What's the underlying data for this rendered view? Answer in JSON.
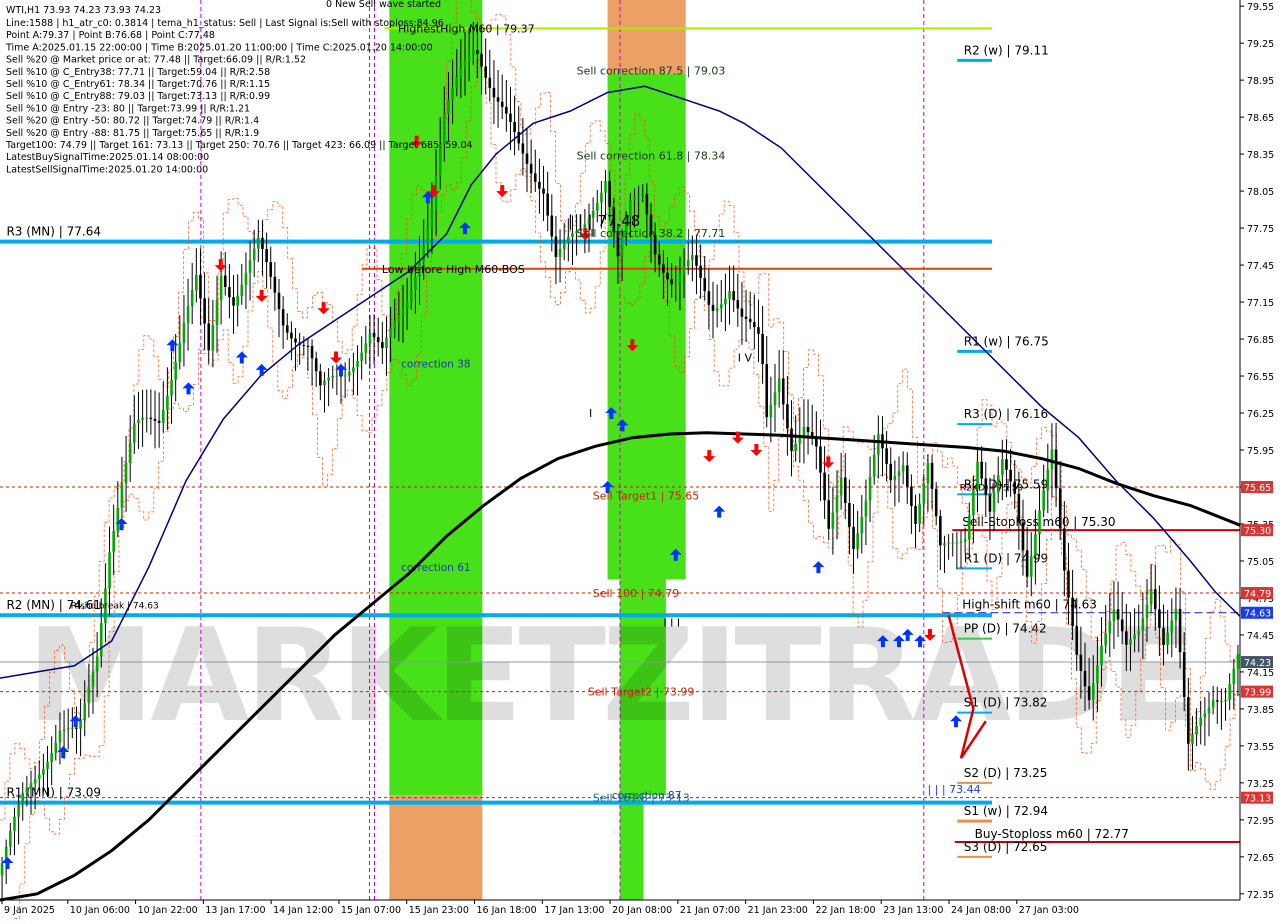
{
  "header": {
    "symbol_line": "WTI,H1  73.93 74.23 73.93 74.23",
    "info_lines": [
      "Line:1588 | h1_atr_c0: 0.3814 | tema_h1_status: Sell | Last Signal is:Sell with stoploss:84.96",
      "Point A:79.37 | Point B:76.68 | Point C:77.48",
      "Time A:2025.01.15 22:00:00 | Time B:2025.01.20 11:00:00 | Time C:2025.01.20 14:00:00",
      "Sell %20 @ Market price or at: 77.48 || Target:66.09 || R/R:1.52",
      "Sell %10 @ C_Entry38: 77.71 || Target:59.04 || R/R:2.58",
      "Sell %10 @ C_Entry61: 78.34 || Target:70.76 || R/R:1.15",
      "Sell %10 @ C_Entry88: 79.03 || Target:73.13 || R/R:0.99",
      "Sell %10 @ Entry -23: 80 || Target:73.99 || R/R:1.21",
      "Sell %20 @ Entry -50: 80.72 || Target:74.79 || R/R:1.4",
      "Sell %20 @ Entry -88: 81.75 || Target:75.65 || R/R:1.9",
      "Target100: 74.79 || Target 161: 73.13 || Target 250: 70.76 || Target 423: 66.09 || Target 685: 59.04",
      "LatestBuySignalTime:2025.01.14 08:00:00",
      "LatestSellSignalTime:2025.01.20 14:00:00"
    ],
    "top_note": "0 New Sell wave started"
  },
  "watermark": "MARKETZITRADE",
  "colors": {
    "background": "#ffffff",
    "up_candle": "#00aa00",
    "down_candle": "#000000",
    "ma_fast": "#000080",
    "ma_slow": "#000000",
    "band": "#ff4500",
    "pivot_line": "#00aaee",
    "green_zone": "#33dd00",
    "orange_zone": "#e8904a",
    "level_red": "#cc0000",
    "hh_line": "#aaee00",
    "buy_arrow": "#0033ff",
    "sell_arrow": "#ff0000"
  },
  "chart_data": {
    "type": "candlestick",
    "symbol": "WTI",
    "timeframe": "H1",
    "ohlc_last": {
      "open": 73.93,
      "high": 74.23,
      "low": 73.93,
      "close": 74.23
    },
    "ylim": [
      72.3,
      79.6
    ],
    "price_ticks": [
      "79.55",
      "79.25",
      "78.95",
      "78.65",
      "78.35",
      "78.05",
      "77.75",
      "77.45",
      "77.15",
      "76.85",
      "76.55",
      "76.25",
      "75.95",
      "75.65",
      "75.35",
      "75.05",
      "74.75",
      "74.45",
      "74.15",
      "73.85",
      "73.55",
      "73.25",
      "72.95",
      "72.65",
      "72.35"
    ],
    "time_labels": [
      "9 Jan 2025",
      "10 Jan 06:00",
      "10 Jan 22:00",
      "13 Jan 17:00",
      "14 Jan 12:00",
      "15 Jan 07:00",
      "15 Jan 23:00",
      "16 Jan 18:00",
      "17 Jan 13:00",
      "20 Jan 08:00",
      "21 Jan 07:00",
      "21 Jan 23:00",
      "22 Jan 18:00",
      "23 Jan 13:00",
      "24 Jan 08:00",
      "27 Jan 03:00"
    ],
    "price_path": [
      [
        0,
        72.5
      ],
      [
        0.02,
        73.1
      ],
      [
        0.05,
        73.7
      ],
      [
        0.065,
        73.6
      ],
      [
        0.08,
        74.3
      ],
      [
        0.09,
        75.2
      ],
      [
        0.1,
        75.7
      ],
      [
        0.11,
        76.1
      ],
      [
        0.13,
        76.2
      ],
      [
        0.15,
        77.0
      ],
      [
        0.16,
        77.3
      ],
      [
        0.17,
        76.7
      ],
      [
        0.18,
        77.4
      ],
      [
        0.19,
        77.2
      ],
      [
        0.21,
        77.6
      ],
      [
        0.23,
        77.0
      ],
      [
        0.25,
        76.8
      ],
      [
        0.26,
        76.4
      ],
      [
        0.28,
        76.6
      ],
      [
        0.3,
        76.9
      ],
      [
        0.31,
        76.7
      ],
      [
        0.33,
        77.2
      ],
      [
        0.35,
        77.9
      ],
      [
        0.36,
        78.6
      ],
      [
        0.375,
        79.1
      ],
      [
        0.385,
        79.3
      ],
      [
        0.4,
        78.8
      ],
      [
        0.42,
        78.4
      ],
      [
        0.44,
        78.1
      ],
      [
        0.45,
        77.5
      ],
      [
        0.47,
        77.7
      ],
      [
        0.49,
        78.2
      ],
      [
        0.5,
        77.5
      ],
      [
        0.51,
        77.9
      ],
      [
        0.52,
        78.0
      ],
      [
        0.53,
        77.6
      ],
      [
        0.545,
        77.3
      ],
      [
        0.56,
        77.45
      ],
      [
        0.575,
        77.1
      ],
      [
        0.59,
        77.3
      ],
      [
        0.6,
        77.0
      ],
      [
        0.615,
        76.8
      ],
      [
        0.62,
        76.2
      ],
      [
        0.63,
        76.6
      ],
      [
        0.64,
        76.0
      ],
      [
        0.65,
        76.1
      ],
      [
        0.66,
        75.9
      ],
      [
        0.67,
        75.3
      ],
      [
        0.68,
        75.8
      ],
      [
        0.69,
        75.2
      ],
      [
        0.7,
        75.5
      ],
      [
        0.71,
        76.0
      ],
      [
        0.72,
        75.7
      ],
      [
        0.73,
        75.9
      ],
      [
        0.74,
        75.4
      ],
      [
        0.75,
        75.8
      ],
      [
        0.76,
        75.1
      ],
      [
        0.78,
        75.3
      ],
      [
        0.79,
        75.9
      ],
      [
        0.8,
        75.4
      ],
      [
        0.81,
        75.8
      ],
      [
        0.82,
        75.6
      ],
      [
        0.83,
        75.0
      ],
      [
        0.84,
        75.5
      ],
      [
        0.85,
        75.9
      ],
      [
        0.86,
        74.9
      ],
      [
        0.87,
        74.3
      ],
      [
        0.88,
        74.0
      ],
      [
        0.89,
        74.4
      ],
      [
        0.9,
        74.6
      ],
      [
        0.91,
        74.3
      ],
      [
        0.92,
        74.5
      ],
      [
        0.93,
        74.9
      ],
      [
        0.94,
        74.4
      ],
      [
        0.95,
        74.6
      ],
      [
        0.96,
        73.5
      ],
      [
        0.97,
        73.8
      ],
      [
        0.98,
        74.0
      ],
      [
        0.99,
        73.95
      ],
      [
        1.0,
        74.23
      ]
    ],
    "ma_fast_path": [
      [
        0,
        74.1
      ],
      [
        0.03,
        74.15
      ],
      [
        0.06,
        74.2
      ],
      [
        0.09,
        74.4
      ],
      [
        0.12,
        75.0
      ],
      [
        0.15,
        75.7
      ],
      [
        0.18,
        76.2
      ],
      [
        0.21,
        76.55
      ],
      [
        0.24,
        76.8
      ],
      [
        0.27,
        77.0
      ],
      [
        0.3,
        77.2
      ],
      [
        0.33,
        77.4
      ],
      [
        0.36,
        77.7
      ],
      [
        0.38,
        78.1
      ],
      [
        0.4,
        78.35
      ],
      [
        0.43,
        78.6
      ],
      [
        0.46,
        78.7
      ],
      [
        0.49,
        78.85
      ],
      [
        0.52,
        78.9
      ],
      [
        0.55,
        78.8
      ],
      [
        0.58,
        78.7
      ],
      [
        0.6,
        78.6
      ],
      [
        0.63,
        78.4
      ],
      [
        0.66,
        78.1
      ],
      [
        0.69,
        77.8
      ],
      [
        0.72,
        77.5
      ],
      [
        0.75,
        77.2
      ],
      [
        0.78,
        76.9
      ],
      [
        0.81,
        76.6
      ],
      [
        0.84,
        76.3
      ],
      [
        0.87,
        76.05
      ],
      [
        0.9,
        75.7
      ],
      [
        0.93,
        75.4
      ],
      [
        0.96,
        75.05
      ],
      [
        0.98,
        74.8
      ],
      [
        1.0,
        74.6
      ]
    ],
    "ma_slow_path": [
      [
        0,
        72.3
      ],
      [
        0.03,
        72.35
      ],
      [
        0.06,
        72.5
      ],
      [
        0.09,
        72.7
      ],
      [
        0.12,
        72.95
      ],
      [
        0.15,
        73.25
      ],
      [
        0.18,
        73.55
      ],
      [
        0.21,
        73.85
      ],
      [
        0.24,
        74.15
      ],
      [
        0.27,
        74.45
      ],
      [
        0.3,
        74.7
      ],
      [
        0.33,
        74.95
      ],
      [
        0.36,
        75.25
      ],
      [
        0.39,
        75.5
      ],
      [
        0.42,
        75.72
      ],
      [
        0.45,
        75.88
      ],
      [
        0.48,
        75.98
      ],
      [
        0.51,
        76.05
      ],
      [
        0.54,
        76.08
      ],
      [
        0.57,
        76.09
      ],
      [
        0.6,
        76.08
      ],
      [
        0.63,
        76.07
      ],
      [
        0.66,
        76.05
      ],
      [
        0.69,
        76.03
      ],
      [
        0.72,
        76.01
      ],
      [
        0.75,
        75.99
      ],
      [
        0.78,
        75.97
      ],
      [
        0.81,
        75.94
      ],
      [
        0.84,
        75.88
      ],
      [
        0.87,
        75.8
      ],
      [
        0.9,
        75.68
      ],
      [
        0.93,
        75.58
      ],
      [
        0.96,
        75.5
      ],
      [
        0.98,
        75.42
      ],
      [
        1.0,
        75.34
      ]
    ],
    "zones": [
      {
        "type": "green",
        "x0": 0.314,
        "x1": 0.389,
        "y0": 79.6,
        "y1": 73.15,
        "label": "correction 38",
        "label_y": 76.65
      },
      {
        "type": "orange",
        "x0": 0.314,
        "x1": 0.389,
        "y0": 73.15,
        "y1": 72.3,
        "label": "correction 61",
        "label_y": 75.0
      },
      {
        "type": "orange",
        "x0": 0.49,
        "x1": 0.553,
        "y0": 79.6,
        "y1": 79.0,
        "label": "correction 87",
        "label_y": 73.15
      },
      {
        "type": "green",
        "x0": 0.49,
        "x1": 0.553,
        "y0": 79.0,
        "y1": 74.9,
        "label": "",
        "label_y": 0
      },
      {
        "type": "green",
        "x0": 0.5,
        "x1": 0.537,
        "y0": 74.9,
        "y1": 73.15,
        "label": "",
        "label_y": 0
      },
      {
        "type": "green",
        "x0": 0.5,
        "x1": 0.519,
        "y0": 73.15,
        "y1": 72.3,
        "label": "",
        "label_y": 0
      }
    ],
    "zone_labels": [
      {
        "text": "Sell correction 87.5 | 79.03",
        "x": 0.465,
        "y": 79.03,
        "color": "#1a3a1a"
      },
      {
        "text": "Sell correction 61.8 | 78.34",
        "x": 0.465,
        "y": 78.34,
        "color": "#1a3a1a"
      },
      {
        "text": "Sell correction 38.2 | 77.71",
        "x": 0.465,
        "y": 77.71,
        "color": "#1a3a1a"
      },
      {
        "text": "Sell Target1 | 75.65",
        "x": 0.478,
        "y": 75.58,
        "color": "#cc2200"
      },
      {
        "text": "Sell 100 | 74.79",
        "x": 0.478,
        "y": 74.79,
        "color": "#cc2200"
      },
      {
        "text": "Sell Target2 | 73.99",
        "x": 0.474,
        "y": 73.99,
        "color": "#cc2200"
      },
      {
        "text": "Sell 161.8 | 73.13",
        "x": 0.478,
        "y": 73.13,
        "color": "#1a6aaa"
      },
      {
        "text": "| | | 77.48",
        "x": 0.458,
        "y": 77.8,
        "color": "#000000"
      },
      {
        "text": "I V",
        "x": 0.595,
        "y": 76.7,
        "color": "#000000"
      },
      {
        "text": "I",
        "x": 0.475,
        "y": 76.25,
        "color": "#000000"
      },
      {
        "text": "I I I",
        "x": 0.535,
        "y": 74.55,
        "color": "#000000"
      },
      {
        "text": "| | | 73.44",
        "x": 0.748,
        "y": 73.2,
        "color": "#1a3aff"
      },
      {
        "text": "Low before High   M60-BOS",
        "x": 0.308,
        "y": 77.42,
        "color": "#000000"
      },
      {
        "text": "HighestHigh   M60 | 79.37",
        "x": 0.321,
        "y": 79.37,
        "color": "#000000"
      },
      {
        "text": "I New Sell wave started",
        "x": 0.26,
        "y": 79.65,
        "color": "#000000"
      }
    ],
    "pivots": [
      {
        "label": "R3 (MN) | 77.64",
        "value": 77.64,
        "x0": 0.0,
        "x1": 0.8,
        "color": "#00aaee",
        "width": 4,
        "label_x": 0.002
      },
      {
        "label": "R2 (MN) | 74.61",
        "value": 74.61,
        "x0": 0.0,
        "x1": 0.8,
        "color": "#00aaee",
        "width": 4,
        "label_x": 0.002
      },
      {
        "label": "R1 (MN) | 73.09",
        "value": 73.09,
        "x0": 0.0,
        "x1": 0.8,
        "color": "#00aaee",
        "width": 4,
        "label_x": 0.002
      },
      {
        "label": "R2 (w) | 79.11",
        "value": 79.11,
        "x0": 0.772,
        "x1": 0.8,
        "color": "#00aaee",
        "width": 3,
        "label_x": 0.774
      },
      {
        "label": "R1 (w) | 76.75",
        "value": 76.75,
        "x0": 0.772,
        "x1": 0.8,
        "color": "#00aaee",
        "width": 3,
        "label_x": 0.774
      },
      {
        "label": "R3 (D) | 76.16",
        "value": 76.16,
        "x0": 0.772,
        "x1": 0.8,
        "color": "#00aaee",
        "width": 2,
        "label_x": 0.774
      },
      {
        "label": "R2 (D) | 75.59",
        "value": 75.59,
        "x0": 0.772,
        "x1": 0.8,
        "color": "#00aaee",
        "width": 2,
        "label_x": 0.774
      },
      {
        "label": "R1 (D) | 74.99",
        "value": 74.99,
        "x0": 0.772,
        "x1": 0.8,
        "color": "#00aaee",
        "width": 2,
        "label_x": 0.774
      },
      {
        "label": "PP (D) | 74.42",
        "value": 74.42,
        "x0": 0.772,
        "x1": 0.8,
        "color": "#33cc33",
        "width": 2,
        "label_x": 0.774
      },
      {
        "label": "S1 (D) | 73.82",
        "value": 73.82,
        "x0": 0.772,
        "x1": 0.8,
        "color": "#00aaee",
        "width": 2,
        "label_x": 0.774
      },
      {
        "label": "S2 (D) | 73.25",
        "value": 73.25,
        "x0": 0.772,
        "x1": 0.8,
        "color": "#e8904a",
        "width": 2,
        "label_x": 0.774
      },
      {
        "label": "S1 (w) | 72.94",
        "value": 72.94,
        "x0": 0.772,
        "x1": 0.8,
        "color": "#e8904a",
        "width": 3,
        "label_x": 0.774
      },
      {
        "label": "S3 (D) | 72.65",
        "value": 72.65,
        "x0": 0.772,
        "x1": 0.8,
        "color": "#e8904a",
        "width": 2,
        "label_x": 0.774
      }
    ],
    "levels": [
      {
        "label": "Sell-Stoploss m60 | 75.30",
        "value": 75.3,
        "x0": 0.768,
        "x1": 1.0,
        "color": "#cc0000",
        "style": "solid",
        "width": 2,
        "label_x": 0.776
      },
      {
        "label": "High-shift m60 | 74.63",
        "value": 74.63,
        "x0": 0.76,
        "x1": 1.0,
        "color": "#1a1aaa",
        "style": "dashed",
        "width": 1,
        "label_x": 0.776
      },
      {
        "label": "Buy-Stoploss m60 | 72.77",
        "value": 72.77,
        "x0": 0.77,
        "x1": 1.0,
        "color": "#cc0000",
        "style": "solid",
        "width": 2,
        "label_x": 0.786
      },
      {
        "label": "",
        "value": 77.42,
        "x0": 0.292,
        "x1": 0.8,
        "color": "#e0400a",
        "style": "solid",
        "width": 2,
        "label_x": 0
      },
      {
        "label": "",
        "value": 79.37,
        "x0": 0.31,
        "x1": 0.8,
        "color": "#aaee00",
        "style": "solid",
        "width": 2,
        "label_x": 0
      },
      {
        "label": "",
        "value": 75.65,
        "x0": 0.0,
        "x1": 1.0,
        "color": "#cc2200",
        "style": "dotted",
        "width": 1,
        "label_x": 0
      },
      {
        "label": "",
        "value": 74.79,
        "x0": 0.0,
        "x1": 1.0,
        "color": "#cc2200",
        "style": "dotted",
        "width": 1,
        "label_x": 0
      },
      {
        "label": "",
        "value": 73.99,
        "x0": 0.0,
        "x1": 1.0,
        "color": "#cc2200",
        "style": "dotted",
        "width": 1,
        "label_x": 0
      },
      {
        "label": "",
        "value": 73.13,
        "x0": 0.0,
        "x1": 1.0,
        "color": "#cc2200",
        "style": "dotted",
        "width": 1,
        "label_x": 0
      },
      {
        "label": "",
        "value": 74.23,
        "x0": 0.0,
        "x1": 1.0,
        "color": "#8899aa",
        "style": "solid",
        "width": 1,
        "label_x": 0
      }
    ],
    "price_labels": [
      {
        "text": "75.65",
        "value": 75.65,
        "bg": "#dd3333"
      },
      {
        "text": "75.30",
        "value": 75.3,
        "bg": "#dd3333"
      },
      {
        "text": "74.79",
        "value": 74.79,
        "bg": "#dd3333"
      },
      {
        "text": "74.63",
        "value": 74.63,
        "bg": "#1a3aee"
      },
      {
        "text": "74.23",
        "value": 74.23,
        "bg": "#445566"
      },
      {
        "text": "73.99",
        "value": 73.99,
        "bg": "#dd3333"
      },
      {
        "text": "73.13",
        "value": 73.13,
        "bg": "#dd3333"
      }
    ],
    "extra_labels": [
      {
        "text": "R2 (D) | 75.59",
        "x": 0.774,
        "y": 75.59
      },
      {
        "text": "Rfshdibreak | 74.63",
        "x": 0.057,
        "y": 74.63
      }
    ],
    "buy_arrows": [
      [
        0.006,
        72.6
      ],
      [
        0.051,
        73.5
      ],
      [
        0.061,
        73.75
      ],
      [
        0.098,
        75.35
      ],
      [
        0.139,
        76.8
      ],
      [
        0.152,
        76.45
      ],
      [
        0.195,
        76.7
      ],
      [
        0.211,
        76.6
      ],
      [
        0.275,
        76.6
      ],
      [
        0.345,
        78.0
      ],
      [
        0.375,
        77.75
      ],
      [
        0.49,
        75.65
      ],
      [
        0.493,
        76.25
      ],
      [
        0.502,
        76.15
      ],
      [
        0.545,
        75.1
      ],
      [
        0.58,
        75.45
      ],
      [
        0.66,
        75.0
      ],
      [
        0.712,
        74.4
      ],
      [
        0.725,
        74.4
      ],
      [
        0.732,
        74.45
      ],
      [
        0.742,
        74.4
      ],
      [
        0.771,
        73.75
      ]
    ],
    "sell_arrows": [
      [
        0.178,
        77.45
      ],
      [
        0.211,
        77.2
      ],
      [
        0.261,
        77.1
      ],
      [
        0.271,
        76.7
      ],
      [
        0.336,
        78.45
      ],
      [
        0.35,
        78.05
      ],
      [
        0.405,
        78.05
      ],
      [
        0.472,
        77.7
      ],
      [
        0.51,
        76.8
      ],
      [
        0.572,
        75.9
      ],
      [
        0.595,
        76.05
      ],
      [
        0.61,
        75.95
      ],
      [
        0.668,
        75.85
      ],
      [
        0.75,
        74.45
      ]
    ],
    "dashed_vlines": [
      0.162,
      0.298,
      0.302,
      0.5,
      0.745
    ]
  }
}
